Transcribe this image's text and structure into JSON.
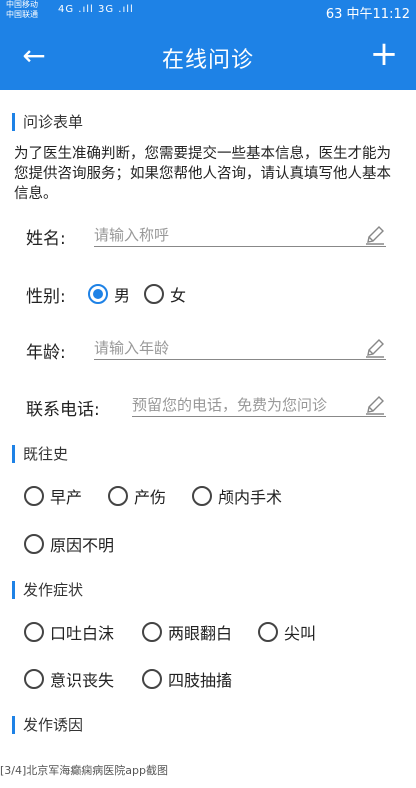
{
  "status_bar": {
    "carrier1": "中国移动",
    "carrier2": "中国联通",
    "signals": "4G .ıll 3G .ıll",
    "right": "63 中午11:12"
  },
  "appbar": {
    "title": "在线问诊",
    "back_icon": "←",
    "add_icon": "+"
  },
  "form": {
    "section_title": "问诊表单",
    "description": "为了医生准确判断，您需要提交一些基本信息，医生才能为您提供咨询服务；如果您帮他人咨询，请认真填写他人基本信息。",
    "name_label": "姓名:",
    "name_placeholder": "请输入称呼",
    "gender_label": "性别:",
    "gender_options": [
      "男",
      "女"
    ],
    "gender_selected": "男",
    "age_label": "年龄:",
    "age_placeholder": "请输入年龄",
    "phone_label": "联系电话:",
    "phone_placeholder": "预留您的电话，免费为您问诊"
  },
  "history": {
    "title": "既往史",
    "options": [
      "早产",
      "产伤",
      "颅内手术",
      "原因不明"
    ]
  },
  "symptoms": {
    "title": "发作症状",
    "options": [
      "口吐白沫",
      "两眼翻白",
      "尖叫",
      "意识丧失",
      "四肢抽搐"
    ]
  },
  "triggers": {
    "title": "发作诱因"
  },
  "caption": "[3/4]北京军海癫痫病医院app截图",
  "colors": {
    "primary": "#1E82E6"
  }
}
